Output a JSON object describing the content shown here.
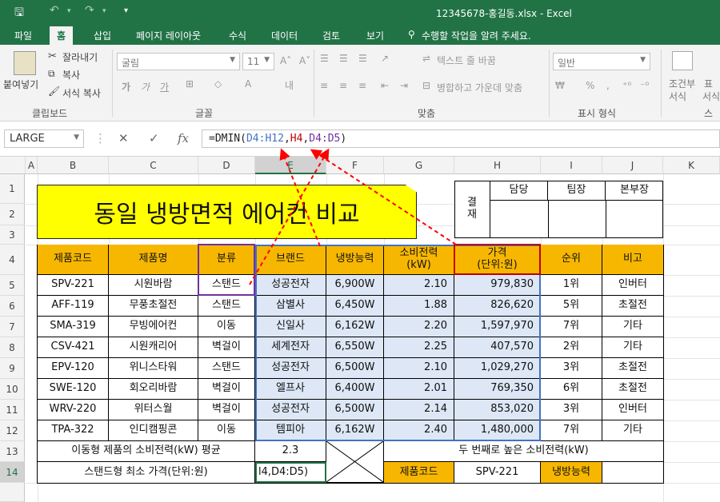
{
  "titlebar": {
    "save_icon": "save-icon",
    "undo_icon": "undo-icon",
    "redo_icon": "redo-icon",
    "customize_icon": "customize-icon",
    "document_title": "12345678-홍길동.xlsx - Excel"
  },
  "menu": {
    "file": "파일",
    "home": "홈",
    "insert": "삽입",
    "page_layout": "페이지 레이아웃",
    "formulas": "수식",
    "data": "데이터",
    "review": "검토",
    "view": "보기",
    "tell_me": "수행할 작업을 알려 주세요."
  },
  "ribbon": {
    "paste": "붙여넣기",
    "cut": "잘라내기",
    "copy": "복사",
    "format_painter": "서식 복사",
    "clipboard_group": "클립보드",
    "font_name": "굴림",
    "font_size": "11",
    "bold": "가",
    "italic": "가",
    "underline": "가",
    "font_group": "글꼴",
    "wrap_text": "텍스트 줄 바꿈",
    "merge_center": "병합하고 가운데 맞춤",
    "alignment_group": "맞춤",
    "number_format": "일반",
    "percent": "%",
    "comma": ",",
    "number_group": "표시 형식",
    "conditional_format_1": "조건부",
    "conditional_format_2": "서식",
    "format_table_1": "표",
    "format_table_2": "서식",
    "styles_group": "스"
  },
  "formula_bar": {
    "name_box": "LARGE",
    "cancel": "✕",
    "enter": "✓",
    "fx": "fx",
    "eq": "=DMIN(",
    "ref1": "D4:H12",
    "comma1": ",",
    "ref2": "H4",
    "comma2": ",",
    "ref3": "D4:D5",
    "close": ")"
  },
  "columns": [
    "A",
    "B",
    "C",
    "D",
    "E",
    "F",
    "G",
    "H",
    "I",
    "J",
    "K"
  ],
  "rows": [
    "1",
    "2",
    "3",
    "4",
    "5",
    "6",
    "7",
    "8",
    "9",
    "10",
    "11",
    "12",
    "13",
    "14"
  ],
  "sheet": {
    "title": "동일 냉방면적 에어컨 비교",
    "approval": {
      "label1": "결",
      "label2": "재",
      "staff": "담당",
      "team_lead": "팀장",
      "division_head": "본부장"
    },
    "headers": {
      "code": "제품코드",
      "name": "제품명",
      "category": "분류",
      "brand": "브랜드",
      "cooling": "냉방능력",
      "power1": "소비전력",
      "power2": "(kW)",
      "price1": "가격",
      "price2": "(단위:원)",
      "rank": "순위",
      "note": "비고"
    },
    "products": [
      {
        "code": "SPV-221",
        "name": "시원바람",
        "category": "스탠드",
        "brand": "성공전자",
        "cooling": "6,900W",
        "power": "2.10",
        "price": "979,830",
        "rank": "1위",
        "note": "인버터"
      },
      {
        "code": "AFF-119",
        "name": "무풍초절전",
        "category": "스탠드",
        "brand": "삼별사",
        "cooling": "6,450W",
        "power": "1.88",
        "price": "826,620",
        "rank": "5위",
        "note": "초절전"
      },
      {
        "code": "SMA-319",
        "name": "무빙에어컨",
        "category": "이동",
        "brand": "신일사",
        "cooling": "6,162W",
        "power": "2.20",
        "price": "1,597,970",
        "rank": "7위",
        "note": "기타"
      },
      {
        "code": "CSV-421",
        "name": "시원캐리어",
        "category": "벽걸이",
        "brand": "세계전자",
        "cooling": "6,550W",
        "power": "2.25",
        "price": "407,570",
        "rank": "2위",
        "note": "기타"
      },
      {
        "code": "EPV-120",
        "name": "위니스타워",
        "category": "스탠드",
        "brand": "성공전자",
        "cooling": "6,500W",
        "power": "2.10",
        "price": "1,029,270",
        "rank": "3위",
        "note": "초절전"
      },
      {
        "code": "SWE-120",
        "name": "회오리바람",
        "category": "벽걸이",
        "brand": "엘프사",
        "cooling": "6,400W",
        "power": "2.01",
        "price": "769,350",
        "rank": "6위",
        "note": "초절전"
      },
      {
        "code": "WRV-220",
        "name": "위터스월",
        "category": "벽걸이",
        "brand": "성공전자",
        "cooling": "6,500W",
        "power": "2.14",
        "price": "853,020",
        "rank": "3위",
        "note": "인버터"
      },
      {
        "code": "TPA-322",
        "name": "인디캠핑콘",
        "category": "이동",
        "brand": "템피아",
        "cooling": "6,162W",
        "power": "2.40",
        "price": "1,480,000",
        "rank": "7위",
        "note": "기타"
      }
    ],
    "summary": {
      "label13": "이동형 제품의 소비전력(kW) 평균",
      "value13": "2.3",
      "label13b": "두 번째로 높은 소비전력(kW)",
      "label14": "스탠드형 최소 가격(단위:원)",
      "edit14": "l4,D4:D5)",
      "code_label": "제품코드",
      "code_value": "SPV-221",
      "cooling_label": "냉방능력"
    }
  },
  "colors": {
    "excel_green": "#217346",
    "header_fill": "#f7b700",
    "title_fill": "#ffff00",
    "ref_blue": "#4472c4",
    "ref_red": "#c00000",
    "ref_purple": "#7030a0",
    "arrow_red": "#ff0000"
  }
}
